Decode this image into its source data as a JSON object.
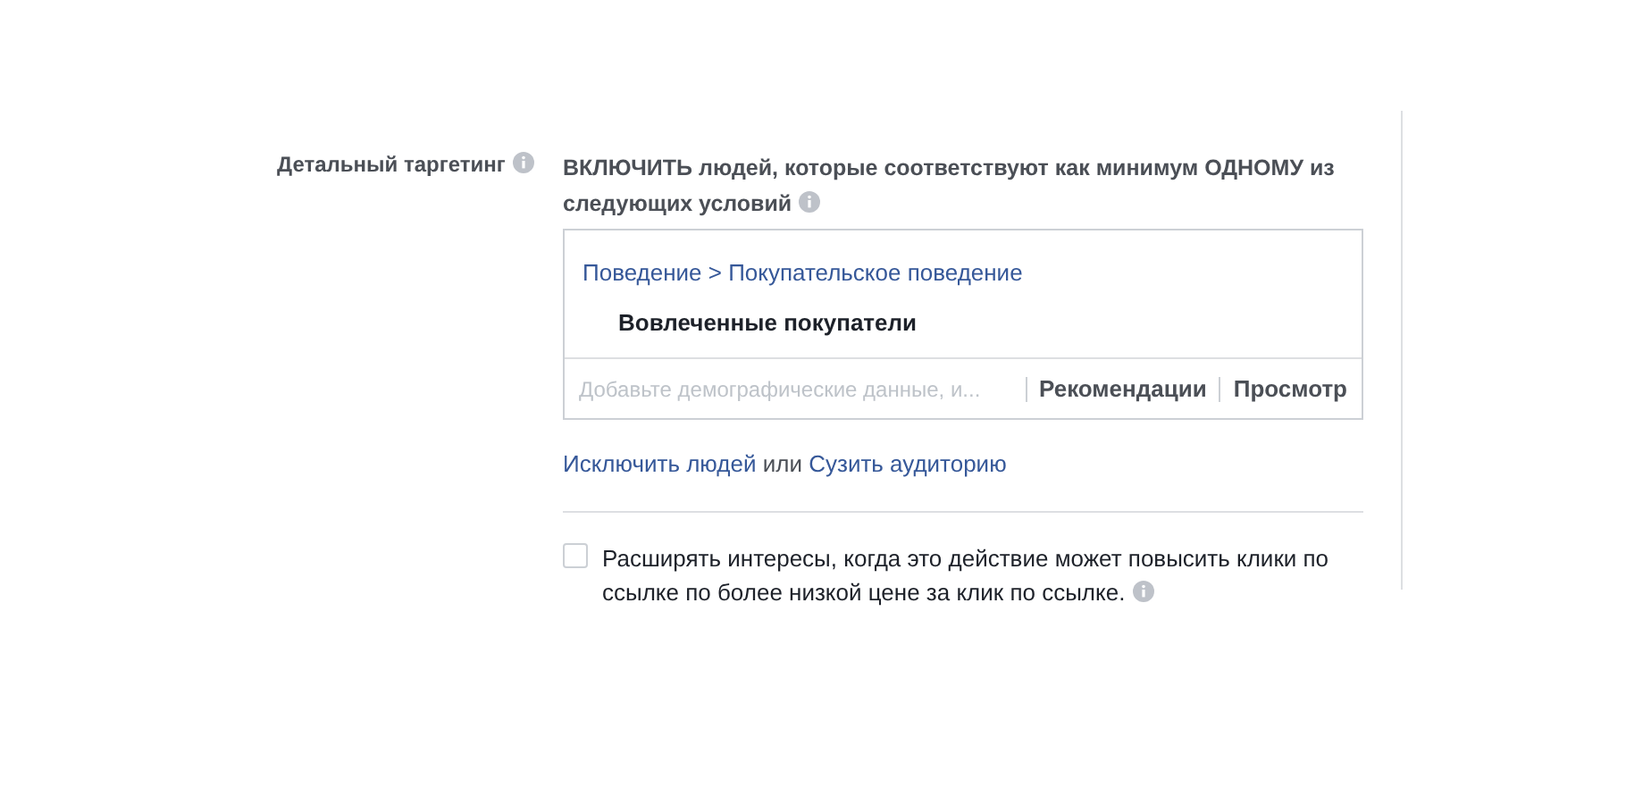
{
  "label": "Детальный таргетинг",
  "heading": "ВКЛЮЧИТЬ людей, которые соответствуют как минимум ОДНОМУ из следующих условий",
  "path": "Поведение > Покупательское поведение",
  "items": [
    "Вовлеченные покупатели"
  ],
  "search": {
    "placeholder": "Добавьте демографические данные, и..."
  },
  "actions": [
    "Рекомендации",
    "Просмотр"
  ],
  "exclude": {
    "link_1": "Исключить людей",
    "joiner": "или",
    "link_2": "Сузить аудиторию"
  },
  "expand": {
    "checked": false,
    "text": "Расширять интересы, когда это действие может повысить клики по ссылке по более низкой цене за клик по ссылке."
  }
}
